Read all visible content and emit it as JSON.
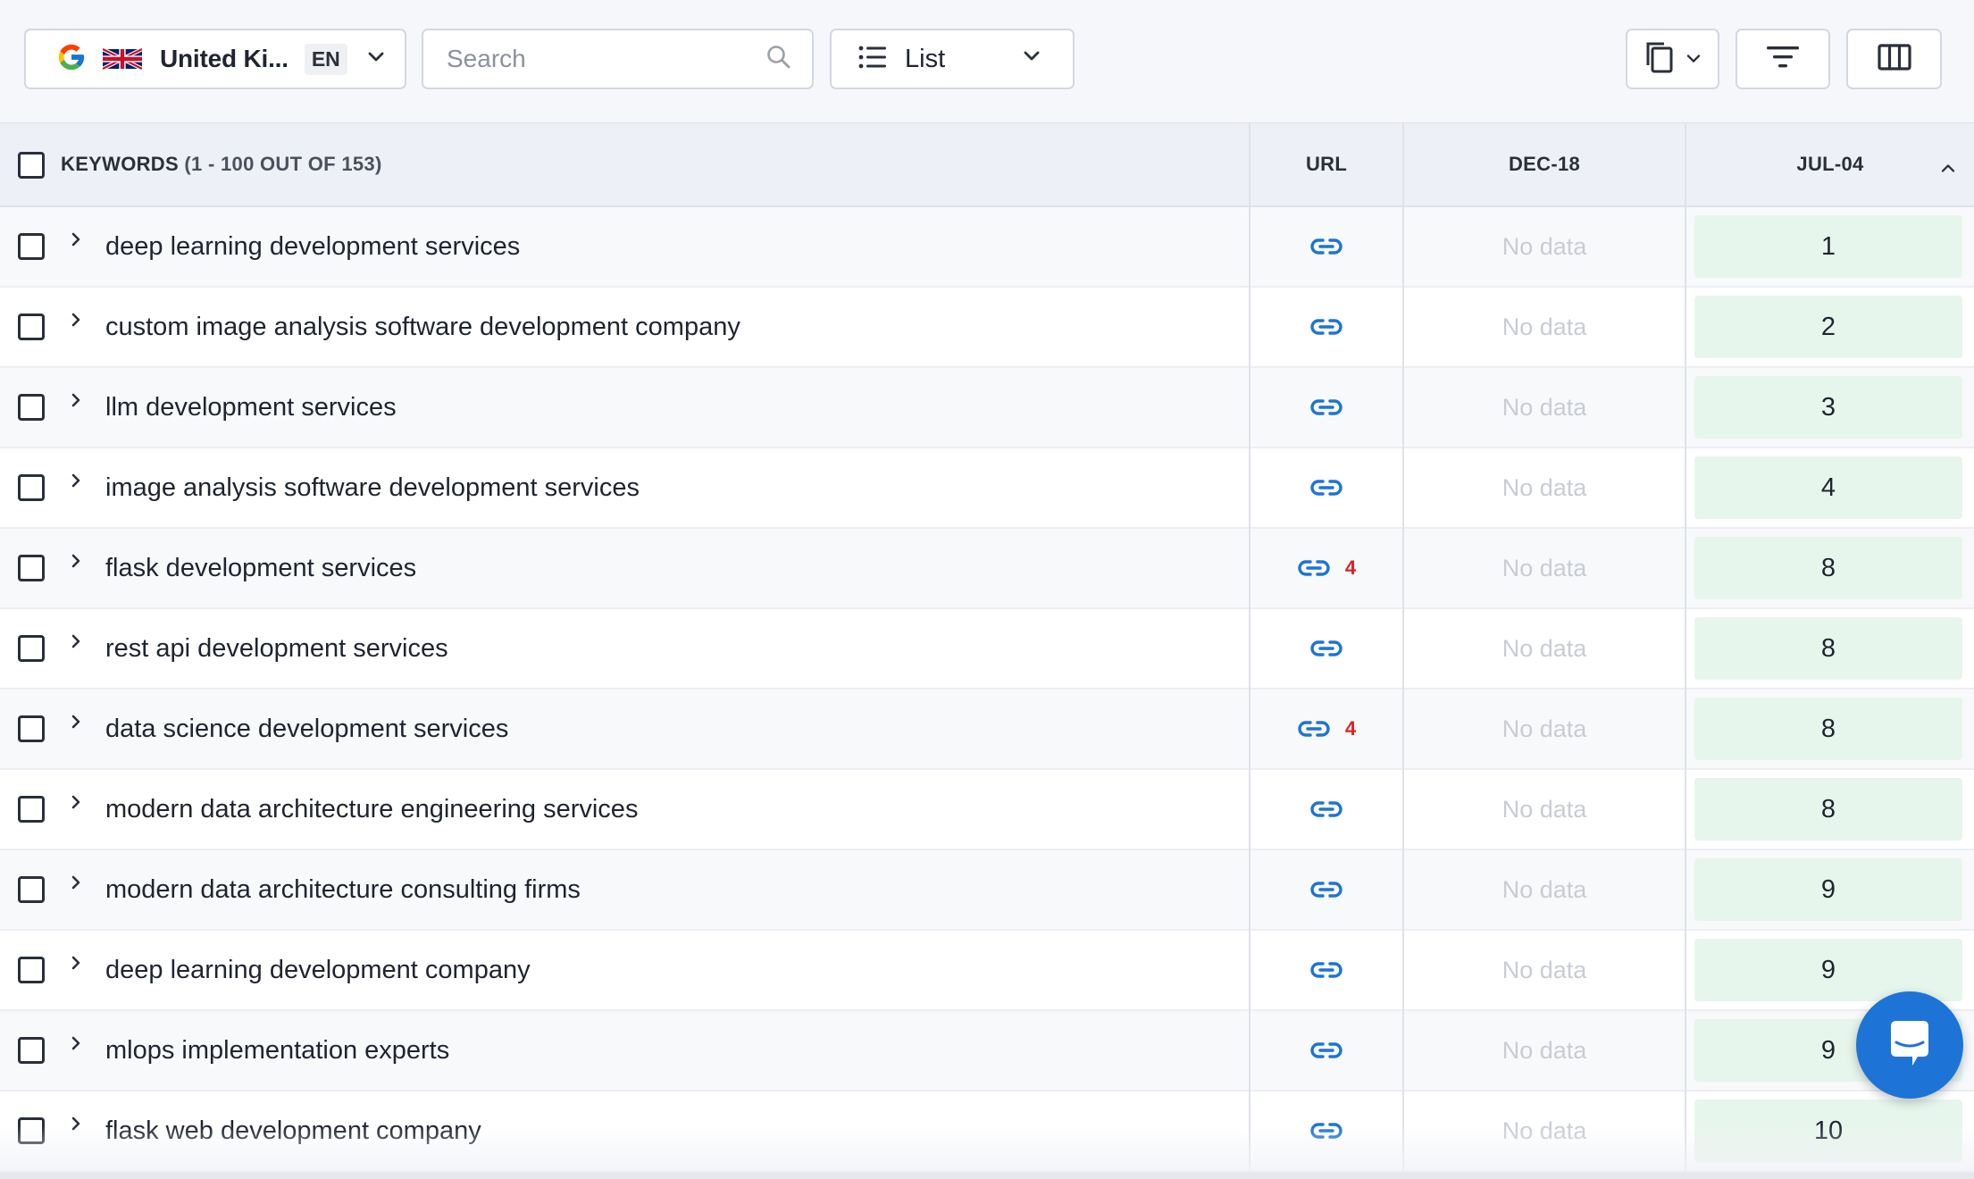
{
  "toolbar": {
    "search_engine_icon": "google-g-icon",
    "flag_icon": "uk-flag-icon",
    "country": "United Ki...",
    "language": "EN",
    "search_placeholder": "Search",
    "view_mode": "List"
  },
  "table": {
    "header": {
      "keywords_label": "KEYWORDS",
      "keywords_count": "(1 - 100 OUT OF 153)",
      "url_label": "URL",
      "dec_label": "DEC-18",
      "jul_label": "JUL-04"
    },
    "rows": [
      {
        "keyword": "deep learning development services",
        "url_count": "",
        "dec": "No data",
        "jul": "1"
      },
      {
        "keyword": "custom image analysis software development company",
        "url_count": "",
        "dec": "No data",
        "jul": "2"
      },
      {
        "keyword": "llm development services",
        "url_count": "",
        "dec": "No data",
        "jul": "3"
      },
      {
        "keyword": "image analysis software development services",
        "url_count": "",
        "dec": "No data",
        "jul": "4"
      },
      {
        "keyword": "flask development services",
        "url_count": "4",
        "dec": "No data",
        "jul": "8"
      },
      {
        "keyword": "rest api development services",
        "url_count": "",
        "dec": "No data",
        "jul": "8"
      },
      {
        "keyword": "data science development services",
        "url_count": "4",
        "dec": "No data",
        "jul": "8"
      },
      {
        "keyword": "modern data architecture engineering services",
        "url_count": "",
        "dec": "No data",
        "jul": "8"
      },
      {
        "keyword": "modern data architecture consulting firms",
        "url_count": "",
        "dec": "No data",
        "jul": "9"
      },
      {
        "keyword": "deep learning development company",
        "url_count": "",
        "dec": "No data",
        "jul": "9"
      },
      {
        "keyword": "mlops implementation experts",
        "url_count": "",
        "dec": "No data",
        "jul": "9"
      },
      {
        "keyword": "flask web development company",
        "url_count": "",
        "dec": "No data",
        "jul": "10"
      }
    ]
  },
  "colors": {
    "link_blue": "#1d74d6",
    "position_bg": "#e7f6ec",
    "count_red": "#e02020"
  }
}
